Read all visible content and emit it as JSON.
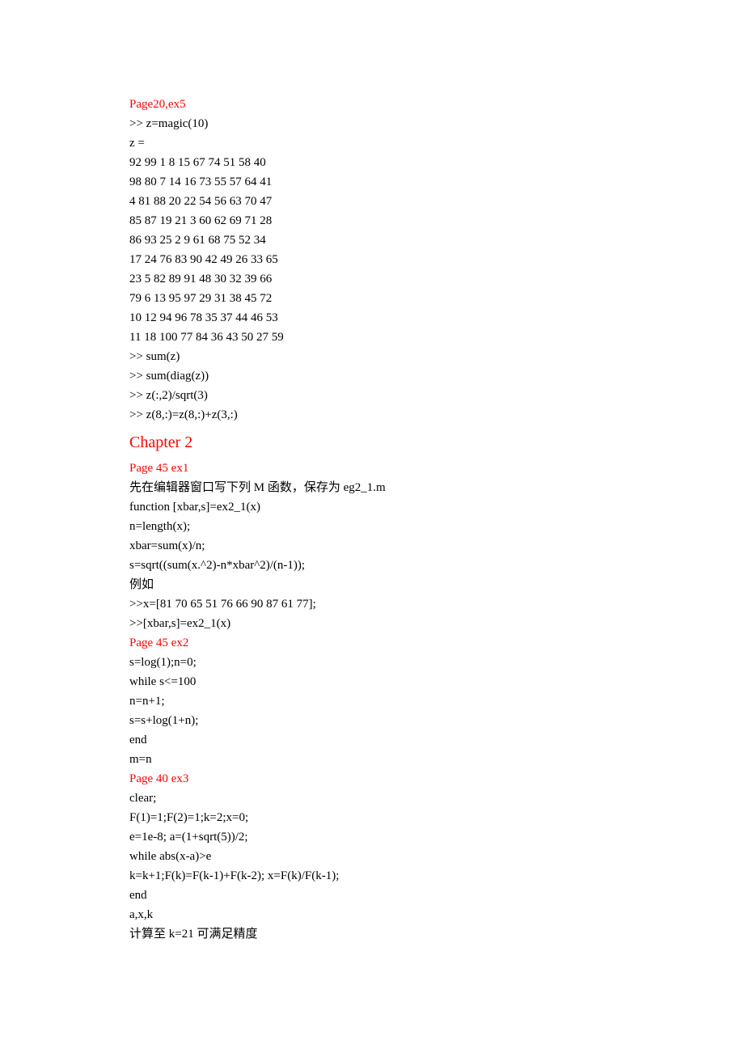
{
  "ex5": {
    "title": "Page20,ex5",
    "lines": [
      ">> z=magic(10)",
      "z =",
      "92 99 1 8 15 67 74 51 58 40",
      "98 80 7 14 16 73 55 57 64 41",
      "4 81 88 20 22 54 56 63 70 47",
      "85 87 19 21 3 60 62 69 71 28",
      "86 93 25 2 9 61 68 75 52 34",
      "17 24 76 83 90 42 49 26 33 65",
      "23 5 82 89 91 48 30 32 39 66",
      "79 6 13 95 97 29 31 38 45 72",
      "10 12 94 96 78 35 37 44 46 53",
      "11 18 100 77 84 36 43 50 27 59",
      ">> sum(z)",
      ">> sum(diag(z))",
      ">> z(:,2)/sqrt(3)",
      ">> z(8,:)=z(8,:)+z(3,:)"
    ]
  },
  "chapter": "Chapter 2",
  "p45ex1": {
    "title": "Page 45 ex1",
    "lines": [
      "先在编辑器窗口写下列 M 函数，保存为 eg2_1.m",
      "function [xbar,s]=ex2_1(x)",
      "n=length(x);",
      "xbar=sum(x)/n;",
      "s=sqrt((sum(x.^2)-n*xbar^2)/(n-1));",
      "例如",
      ">>x=[81 70 65 51 76 66 90 87 61 77];",
      ">>[xbar,s]=ex2_1(x)"
    ]
  },
  "p45ex2": {
    "title": "Page 45 ex2",
    "lines": [
      "s=log(1);n=0;",
      "while s<=100",
      "n=n+1;",
      "s=s+log(1+n);",
      "end",
      "m=n"
    ]
  },
  "p40ex3": {
    "title": "Page 40 ex3",
    "lines": [
      "clear;",
      "F(1)=1;F(2)=1;k=2;x=0;",
      "e=1e-8; a=(1+sqrt(5))/2;",
      "while abs(x-a)>e",
      "k=k+1;F(k)=F(k-1)+F(k-2); x=F(k)/F(k-1);",
      "end",
      "a,x,k",
      "计算至 k=21 可满足精度"
    ]
  }
}
